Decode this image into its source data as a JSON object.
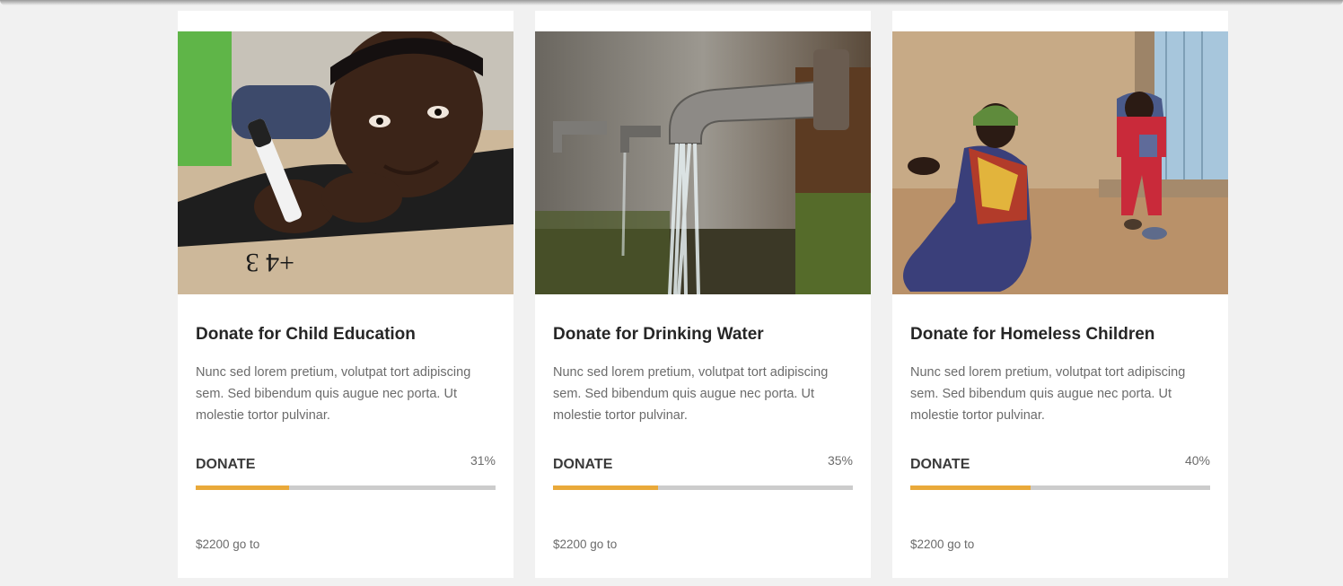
{
  "cards": [
    {
      "title": "Donate for Child Education",
      "description": "Nunc sed lorem pretium, volutpat tort adipiscing sem. Sed bibendum quis augue nec porta. Ut molestie tortor pulvinar.",
      "donate_label": "DONATE",
      "percent_label": "31%",
      "progress": 0.31,
      "goal_text": "$2200 go to",
      "image_subject": "child-writing-math"
    },
    {
      "title": "Donate for Drinking Water",
      "description": "Nunc sed lorem pretium, volutpat tort adipiscing sem. Sed bibendum quis augue nec porta. Ut molestie tortor pulvinar.",
      "donate_label": "DONATE",
      "percent_label": "35%",
      "progress": 0.35,
      "goal_text": "$2200 go to",
      "image_subject": "water-tap"
    },
    {
      "title": "Donate for Homeless Children",
      "description": "Nunc sed lorem pretium, volutpat tort adipiscing sem. Sed bibendum quis augue nec porta. Ut molestie tortor pulvinar.",
      "donate_label": "DONATE",
      "percent_label": "40%",
      "progress": 0.4,
      "goal_text": "$2200 go to",
      "image_subject": "children-sitting-by-wall"
    }
  ],
  "colors": {
    "accent": "#e9a93a",
    "track": "#cccccc",
    "background": "#f1f1f1"
  }
}
